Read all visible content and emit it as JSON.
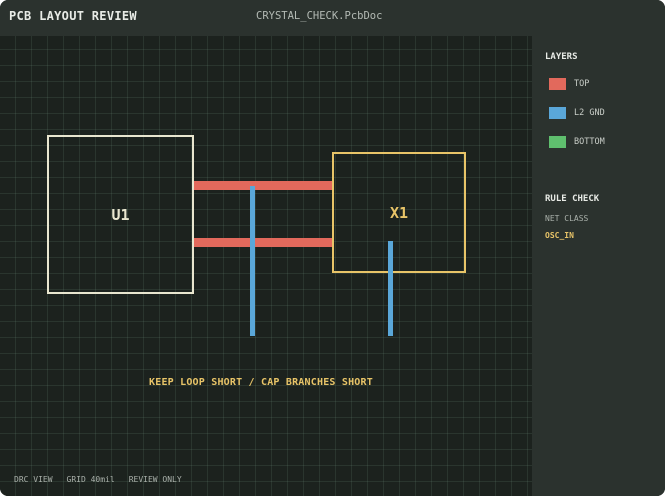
{
  "header": {
    "app_title": "PCB LAYOUT REVIEW",
    "document_title": "CRYSTAL_CHECK.PcbDoc"
  },
  "canvas": {
    "components": [
      {
        "ref": "U1",
        "color": "#e9e6cf"
      },
      {
        "ref": "X1",
        "color": "#e8c468"
      }
    ],
    "note": "KEEP LOOP SHORT / CAP BRANCHES SHORT",
    "status": [
      "DRC VIEW",
      "GRID 40mil",
      "REVIEW ONLY"
    ]
  },
  "layers_panel": {
    "heading": "LAYERS",
    "layers": [
      {
        "label": "TOP",
        "color": "#e2695c"
      },
      {
        "label": "L2 GND",
        "color": "#5aa7d9"
      },
      {
        "label": "BOTTOM",
        "color": "#5fbf6e"
      }
    ]
  },
  "rule_check": {
    "heading": "RULE CHECK",
    "net_class_label": "NET CLASS",
    "net_class_value": "OSC_IN"
  }
}
